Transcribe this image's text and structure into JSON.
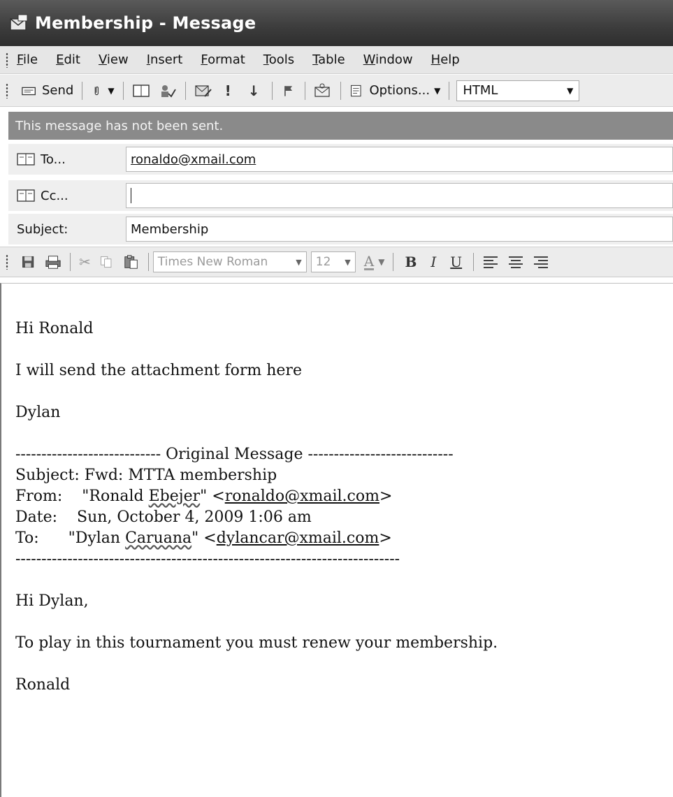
{
  "window": {
    "title": "Membership - Message"
  },
  "menu": [
    "File",
    "Edit",
    "View",
    "Insert",
    "Format",
    "Tools",
    "Table",
    "Window",
    "Help"
  ],
  "toolbar": {
    "send_label": "Send",
    "options_label": "Options...",
    "format_value": "HTML"
  },
  "infobar": {
    "text": "This message has not been sent."
  },
  "fields": {
    "to_label": "To...",
    "to_value": "ronaldo@xmail.com",
    "cc_label": "Cc...",
    "cc_value": "",
    "subject_label": "Subject:",
    "subject_value": "Membership"
  },
  "formatting": {
    "font": "Times New Roman",
    "size": "12"
  },
  "body": {
    "greeting": "Hi Ronald",
    "line1": "I will send the attachment form here",
    "signoff": "Dylan",
    "original_header": "---------------------------- Original Message ----------------------------",
    "orig_subject": "Subject: Fwd: MTTA membership",
    "from_label": "From:    \"Ronald ",
    "from_surname": "Ebejer",
    "from_mid": "\" <",
    "from_email": "ronaldo@xmail.com",
    "from_end": ">",
    "date_line": "Date:    Sun, October 4, 2009 1:06 am",
    "to_label": "To:      \"Dylan ",
    "to_surname": "Caruana",
    "to_mid": "\" <",
    "to_email": "dylancar@xmail.com",
    "to_end": ">",
    "divider": "--------------------------------------------------------------------------",
    "reply_greeting": "Hi Dylan,",
    "reply_line": "To play in this tournament you must renew your membership.",
    "reply_signoff": "Ronald"
  }
}
